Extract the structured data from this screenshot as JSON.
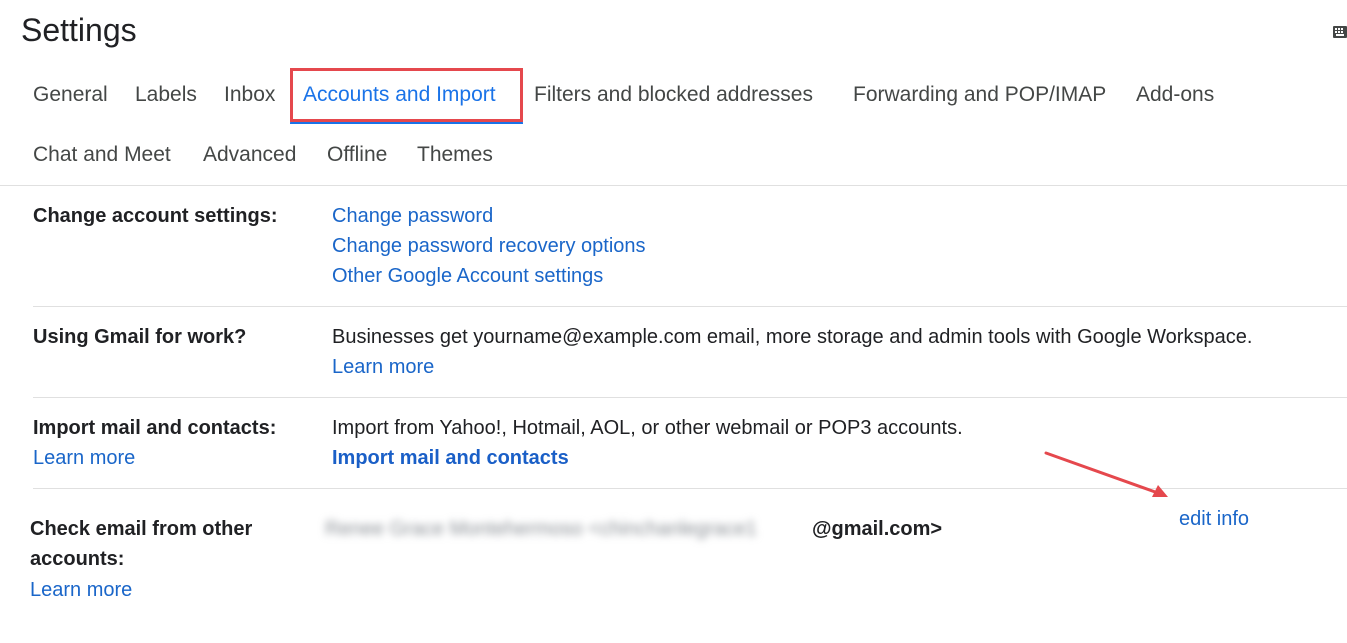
{
  "header": {
    "title": "Settings",
    "keyboard_icon": "keyboard-icon"
  },
  "tabs": [
    {
      "label": "General",
      "active": false
    },
    {
      "label": "Labels",
      "active": false
    },
    {
      "label": "Inbox",
      "active": false
    },
    {
      "label": "Accounts and Import",
      "active": true
    },
    {
      "label": "Filters and blocked addresses",
      "active": false
    },
    {
      "label": "Forwarding and POP/IMAP",
      "active": false
    },
    {
      "label": "Add-ons",
      "active": false
    },
    {
      "label": "Chat and Meet",
      "active": false
    },
    {
      "label": "Advanced",
      "active": false
    },
    {
      "label": "Offline",
      "active": false
    },
    {
      "label": "Themes",
      "active": false
    }
  ],
  "sections": {
    "change_account": {
      "label": "Change account settings:",
      "links": [
        "Change password",
        "Change password recovery options",
        "Other Google Account settings"
      ]
    },
    "work": {
      "label": "Using Gmail for work?",
      "text": "Businesses get yourname@example.com email, more storage and admin tools with Google Workspace.",
      "link": "Learn more"
    },
    "import": {
      "label": "Import mail and contacts:",
      "learn_more": "Learn more",
      "text": "Import from Yahoo!, Hotmail, AOL, or other webmail or POP3 accounts.",
      "action": "Import mail and contacts"
    },
    "check_email": {
      "label_line1": "Check email from other",
      "label_line2": "accounts:",
      "learn_more": "Learn more",
      "account_redacted": "Renee Grace Montehermoso <chinchanlegrace1",
      "account_suffix": "@gmail.com>",
      "edit": "edit info"
    }
  },
  "colors": {
    "accent": "#1a73e8",
    "link": "#1a66c9",
    "annotation": "#e5484d"
  }
}
